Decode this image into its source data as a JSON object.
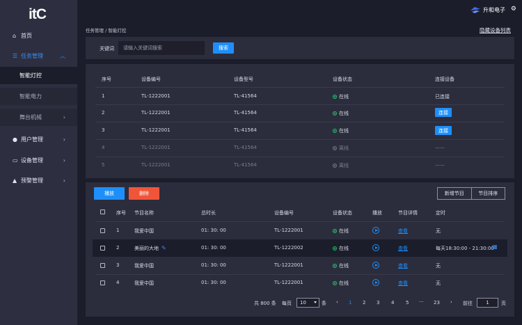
{
  "sidebar": {
    "logo": "itC",
    "home": "首页",
    "task_mgmt": "任务管理",
    "sub": [
      "智能灯控",
      "智能电力",
      "舞台机械"
    ],
    "user_mgmt": "用户管理",
    "device_mgmt": "设备管理",
    "alert_mgmt": "预警管理"
  },
  "topbar": {
    "brand": "升和电子"
  },
  "breadcrumb": "任务管理  /  智能灯控",
  "hide_link": "隐藏设备列表",
  "search": {
    "label": "关键词",
    "placeholder": "请输入关键词搜索",
    "button": "搜索"
  },
  "devices": {
    "headers": [
      "序号",
      "设备编号",
      "设备型号",
      "设备状态",
      "连接设备"
    ],
    "rows": [
      {
        "no": "1",
        "code": "TL-1222001",
        "model": "TL-41564",
        "status": "在线",
        "connect": "已连接"
      },
      {
        "no": "2",
        "code": "TL-1222001",
        "model": "TL-41564",
        "status": "在线",
        "connect": "连接"
      },
      {
        "no": "3",
        "code": "TL-1222001",
        "model": "TL-41564",
        "status": "在线",
        "connect": "连接"
      },
      {
        "no": "4",
        "code": "TL-1222001",
        "model": "TL-41564",
        "status": "离线",
        "connect": "——"
      },
      {
        "no": "5",
        "code": "TL-1222001",
        "model": "TL-41564",
        "status": "离线",
        "connect": "——"
      }
    ]
  },
  "programs": {
    "play_btn": "播放",
    "delete_btn": "删除",
    "add_btn": "新增节目",
    "sort_btn": "节目排序",
    "headers": [
      "序号",
      "节目名称",
      "总时长",
      "设备编号",
      "设备状态",
      "播放",
      "节目详情",
      "定时"
    ],
    "rows": [
      {
        "no": "1",
        "name": "我爱中国",
        "duration": "01:  30:  00",
        "device": "TL-1222001",
        "status": "在线",
        "detail": "查看",
        "timer": "无"
      },
      {
        "no": "2",
        "name": "美丽的大地",
        "duration": "01:  30:  00",
        "device": "TL-1222002",
        "status": "在线",
        "detail": "查看",
        "timer": "每天18:30:00 - 21:30:00"
      },
      {
        "no": "3",
        "name": "我爱中国",
        "duration": "01:  30:  00",
        "device": "TL-1222001",
        "status": "在线",
        "detail": "查看",
        "timer": "无"
      },
      {
        "no": "4",
        "name": "我爱中国",
        "duration": "01:  30:  00",
        "device": "TL-1222001",
        "status": "在线",
        "detail": "查看",
        "timer": "无"
      }
    ]
  },
  "pagination": {
    "total": "共 800 条",
    "per_page_label": "每页",
    "per_page": "10",
    "unit": "条",
    "pages": [
      "1",
      "2",
      "3",
      "4",
      "5",
      "···",
      "23"
    ],
    "goto_label": "前往",
    "goto_value": "1",
    "page_unit": "页"
  },
  "colors": {
    "accent": "#1e8ffa",
    "danger": "#f0553a",
    "online": "#2cc56f",
    "sidebar": "#2d2f40",
    "panel": "#2b2d3d"
  }
}
